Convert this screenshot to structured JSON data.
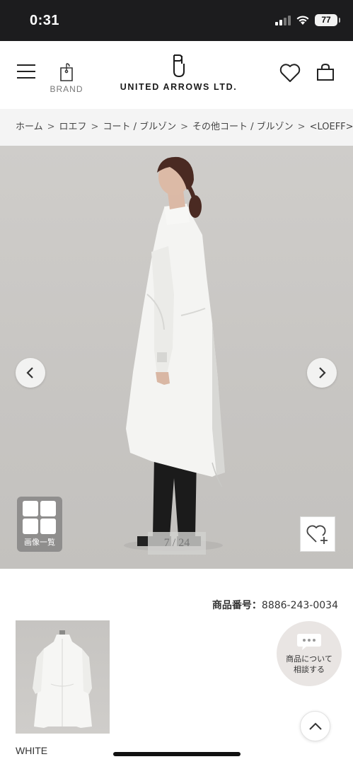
{
  "status_bar": {
    "time": "0:31",
    "battery": "77"
  },
  "header": {
    "brand_label": "BRAND",
    "logo_text": "UNITED ARROWS LTD.",
    "logo_mark": "UA monogram"
  },
  "breadcrumb": {
    "items": [
      "ホーム",
      "ロエフ",
      "コート / ブルゾン",
      "その他コート / ブルゾン",
      "<LOEFF>"
    ],
    "separator": ">"
  },
  "hero": {
    "counter": "7 / 24",
    "gallery_label": "画像一覧",
    "prev_icon": "chevron-left-icon",
    "next_icon": "chevron-right-icon",
    "wishlist_icon": "heart-plus-icon"
  },
  "product": {
    "number_label": "商品番号：",
    "number_value": "8886-243-0034",
    "color": "WHITE"
  },
  "consult": {
    "line1": "商品について",
    "line2": "相談する"
  },
  "colors": {
    "status_bar_bg": "#1c1c1e",
    "breadcrumb_bg": "#f4f4f4",
    "hero_bg": "#c9c7c4",
    "consult_bg": "#e9e5e3"
  }
}
